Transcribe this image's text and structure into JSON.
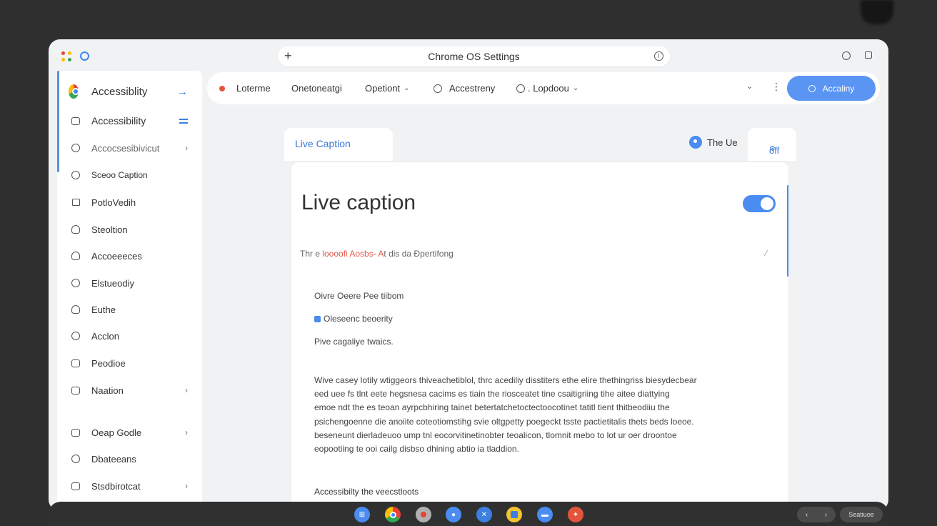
{
  "window": {
    "title": "Chrome OS Settings",
    "plus_glyph": "+",
    "info_glyph": "i"
  },
  "sidebar": {
    "items": [
      {
        "label": "Accessiblity",
        "icon": "chrome-logo-icon",
        "trail": "→"
      },
      {
        "label": "Accessibility",
        "icon": "accessibility-icon",
        "trail": ""
      },
      {
        "label": "Accocsesibivicut",
        "icon": "search-icon",
        "trail": "›"
      },
      {
        "label": "Sceoo Caption",
        "icon": "circle-icon",
        "trail": ""
      },
      {
        "label": "PotloVedih",
        "icon": "home-icon",
        "trail": ""
      },
      {
        "label": "Steoltion",
        "icon": "person-icon",
        "trail": ""
      },
      {
        "label": "Accoeeeces",
        "icon": "people-icon",
        "trail": ""
      },
      {
        "label": "Elstueodiy",
        "icon": "circle-icon",
        "trail": ""
      },
      {
        "label": "Euthe",
        "icon": "person-icon",
        "trail": ""
      },
      {
        "label": "Acclon",
        "icon": "face-icon",
        "trail": ""
      },
      {
        "label": "Peodioe",
        "icon": "monitor-icon",
        "trail": ""
      },
      {
        "label": "Naation",
        "icon": "nav-icon",
        "trail": "›"
      },
      {
        "label": "Oeap Godle",
        "icon": "display-icon",
        "trail": "›"
      },
      {
        "label": "Dbateeans",
        "icon": "database-icon",
        "trail": ""
      },
      {
        "label": "Stsdbirotcat",
        "icon": "shortcut-icon",
        "trail": "›"
      }
    ]
  },
  "topnav": {
    "items": [
      {
        "label": "Loterme",
        "icon": "red-dot-icon"
      },
      {
        "label": "Onetoneatgi",
        "icon": ""
      },
      {
        "label": "Opetiont",
        "icon": "",
        "caret": "⌄"
      },
      {
        "label": "Accestreny",
        "icon": "accessibility-icon"
      },
      {
        "label": ". Lopdoou",
        "icon": "info-icon",
        "caret": "⌄"
      }
    ],
    "chevron": "⌄",
    "more": "⋮",
    "search_label": "Accaliny"
  },
  "content": {
    "tab_label": "Live Caption",
    "tag_label": "The Ue",
    "off_label": "off",
    "off_glyph": "⚙",
    "card_title": "Live caption",
    "toggle_on": true,
    "desc_prefix": "Thr e ",
    "desc_highlight": "loooofi Aosbs- A",
    "desc_suffix": "t dis da Ðpertifong",
    "edit_glyph": "⁄",
    "options": [
      "Oivre Oeere Pee tiibom",
      "Oleseenc beoerity",
      "Pive cagaliye twaics."
    ],
    "paragraph_lines": [
      "Wive casey lotily wtiggeors thiveachetiblol, thrc acediliy disstiters ethe elire thethingriss biesydecbear",
      "eed uee fs tlnt eete hegsnesa cacims es tiain the riosceatet tine csaitigriing tihe aitee diattying",
      "emoe ndt the  es teoan ayrpcbhiring tainet betertatchetoctectoocotinet tatitl tient thitbeodiiu the",
      "psichengoenne die anoiite coteotiomstihg svie oltgpetty poegeckt tsste pactietitalis thets beds loeoe.",
      "beseneunt dierladeuoo ump tnl eocorvitinetinobter teoalicon, tlomnit mebo to lot ur oer droontoe",
      "eopootiing te ooi cailg disbso dhining abtio ia tladdion."
    ],
    "footer": "Accessibilty the veecstloots"
  },
  "shelf": {
    "apps": [
      "files-icon",
      "chrome-icon",
      "gallery-icon",
      "store-icon",
      "calendar-icon",
      "messages-icon",
      "pdf-icon"
    ],
    "nav_prev": "‹",
    "nav_next": "›",
    "tray_label": "Seatiuoe"
  },
  "colors": {
    "accent": "#4a8cf0",
    "highlight_red": "#e05a4a",
    "background": "#2f2f2f"
  }
}
